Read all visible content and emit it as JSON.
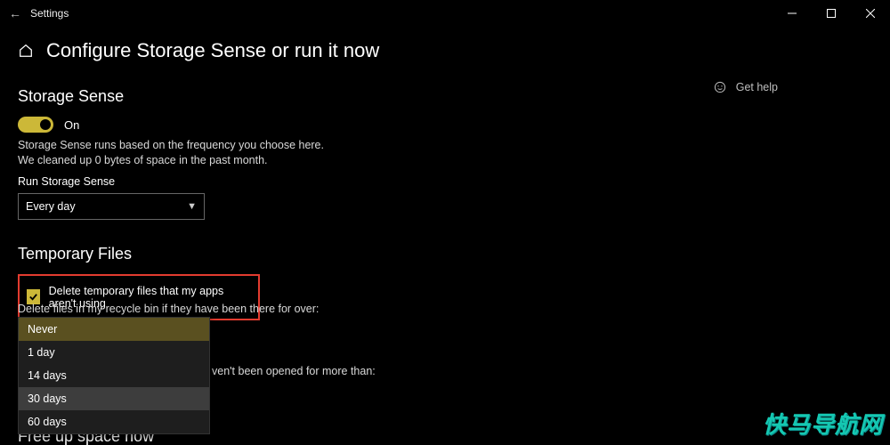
{
  "window": {
    "title": "Settings"
  },
  "header": {
    "page_title": "Configure Storage Sense or run it now"
  },
  "sections": {
    "storage_sense": {
      "heading": "Storage Sense",
      "toggle_state": "On",
      "description": "Storage Sense runs based on the frequency you choose here. We cleaned up 0 bytes of space in the past month.",
      "run_label": "Run Storage Sense",
      "run_value": "Every day"
    },
    "temp_files": {
      "heading": "Temporary Files",
      "checkbox_label": "Delete temporary files that my apps aren't using",
      "recycle_label": "Delete files in my recycle bin if they have been there for over:",
      "downloads_label_tail": "ven't been opened for more than:"
    },
    "free_up": {
      "heading": "Free up space now"
    }
  },
  "dropdown": {
    "options": [
      "Never",
      "1 day",
      "14 days",
      "30 days",
      "60 days"
    ],
    "selected": "Never",
    "hovered": "30 days"
  },
  "help": {
    "label": "Get help"
  },
  "watermark": "快马导航网"
}
